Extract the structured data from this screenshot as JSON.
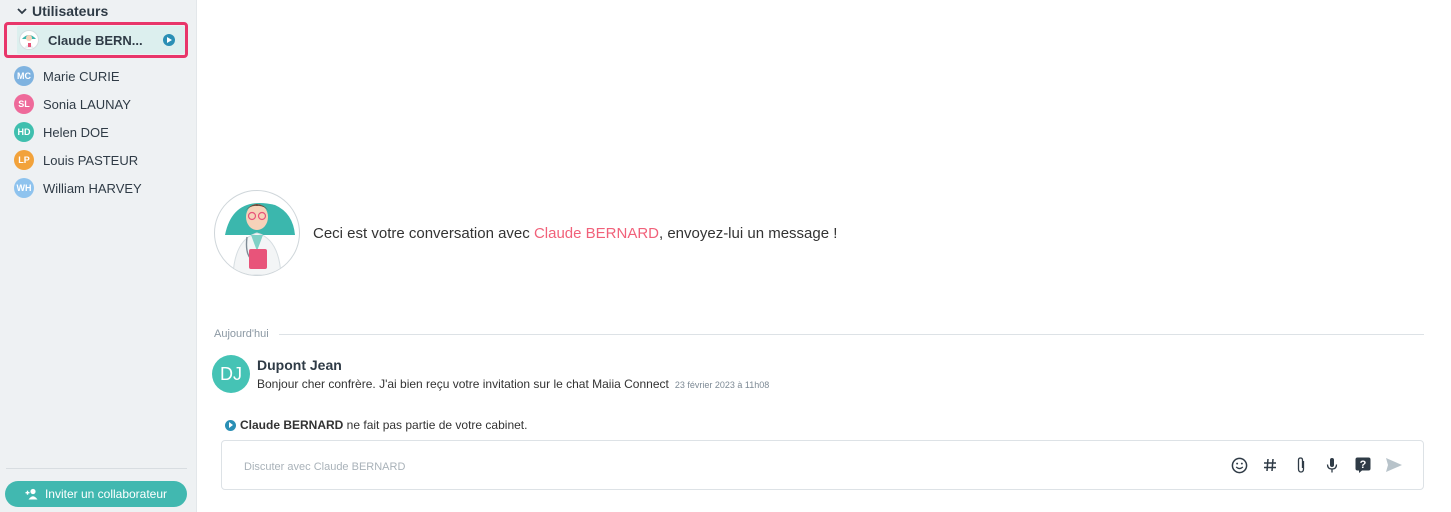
{
  "sidebar": {
    "section_title": "Utilisateurs",
    "users": [
      {
        "name": "Claude BERN...",
        "initials": "",
        "color": "#e7f3f2",
        "active": true
      },
      {
        "name": "Marie CURIE",
        "initials": "MC",
        "color": "#7fb3e0"
      },
      {
        "name": "Sonia LAUNAY",
        "initials": "SL",
        "color": "#ee6a9a"
      },
      {
        "name": "Helen DOE",
        "initials": "HD",
        "color": "#3fbfae"
      },
      {
        "name": "Louis PASTEUR",
        "initials": "LP",
        "color": "#f2a23a"
      },
      {
        "name": "William HARVEY",
        "initials": "WH",
        "color": "#8ec3ee"
      }
    ],
    "invite_label": "Inviter un collaborateur"
  },
  "intro": {
    "prefix": "Ceci est votre conversation avec ",
    "highlight": "Claude BERNARD",
    "suffix": ", envoyez-lui un message !"
  },
  "day_separator": "Aujourd'hui",
  "message": {
    "avatar_initials": "DJ",
    "author": "Dupont Jean",
    "body": "Bonjour cher confrère. J'ai bien reçu votre invitation sur le chat Maiia Connect",
    "time": "23 février 2023 à 11h08"
  },
  "notice": {
    "name": "Claude BERNARD",
    "text": " ne fait pas partie de votre cabinet."
  },
  "composer": {
    "placeholder": "Discuter avec Claude BERNARD",
    "tools": [
      "emoji-icon",
      "hashtag-icon",
      "paperclip-icon",
      "microphone-icon",
      "help-icon",
      "send-icon"
    ]
  },
  "colors": {
    "accent": "#41b8b0",
    "highlight": "#f1617a",
    "active_border": "#e8366a",
    "status": "#2a8fb5"
  }
}
